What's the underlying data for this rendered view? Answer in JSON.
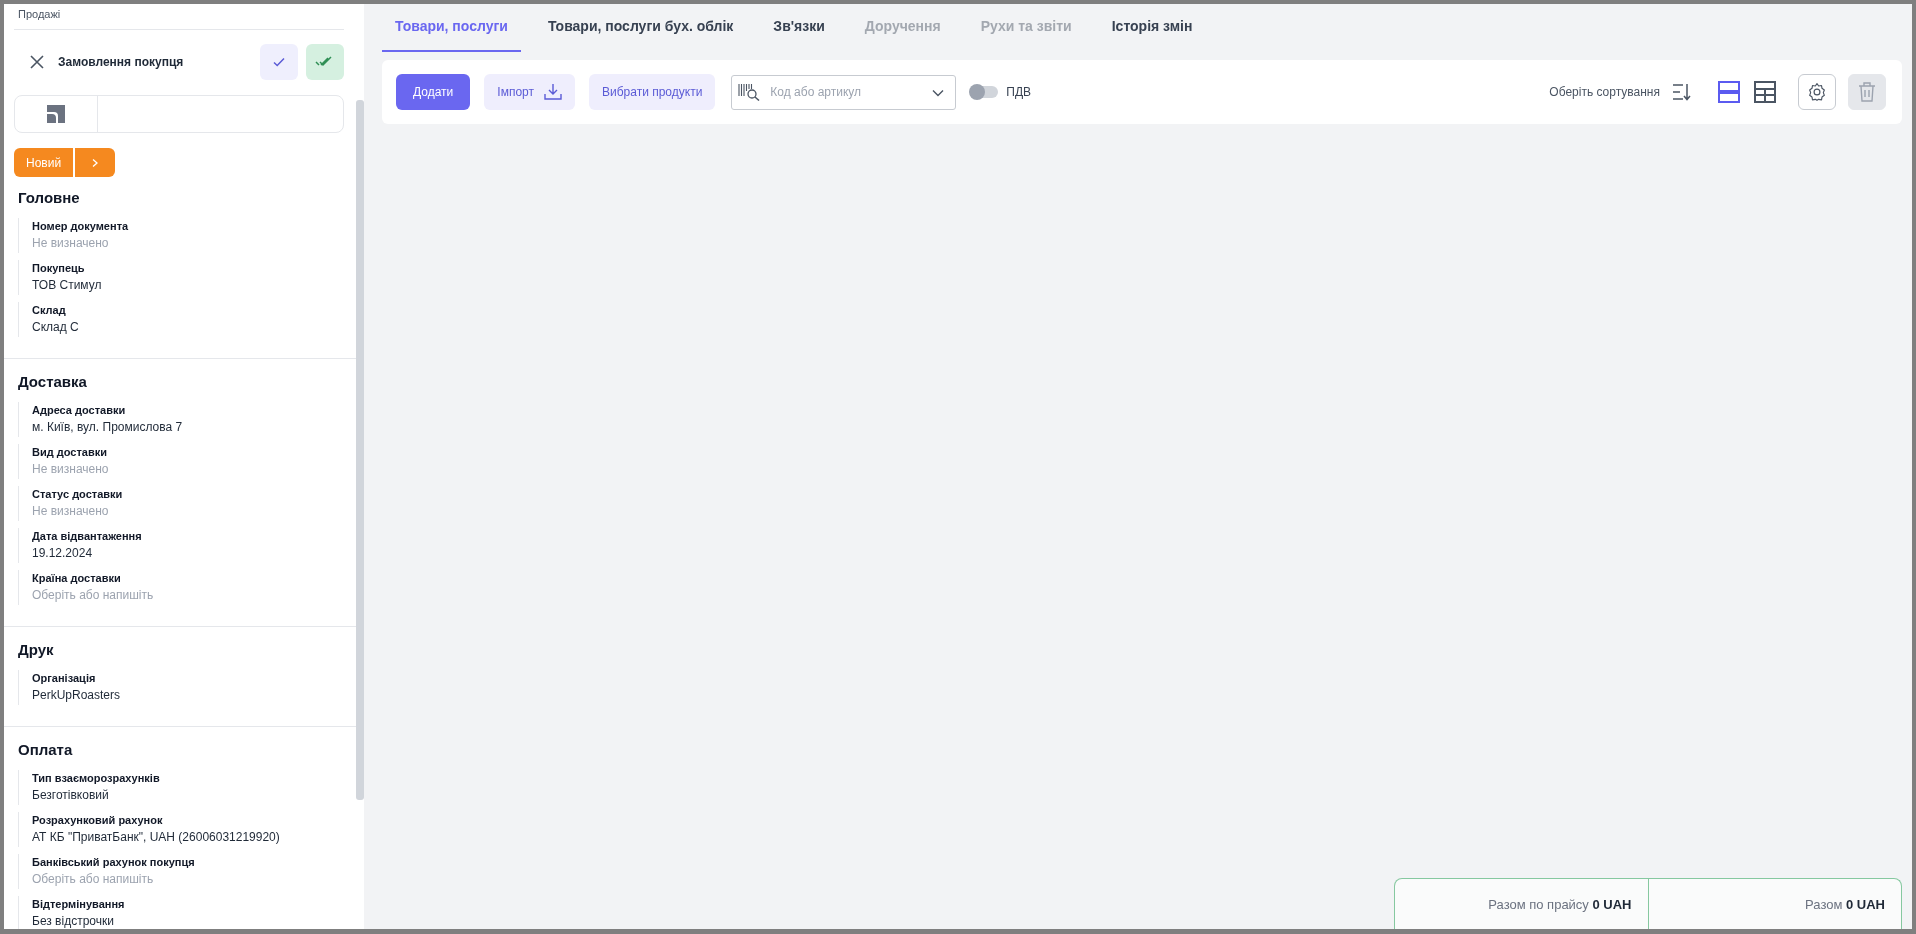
{
  "breadcrumb": "Продажі",
  "document": {
    "title": "Замовлення покупця"
  },
  "status": {
    "label": "Новий"
  },
  "sections": [
    {
      "title": "Головне",
      "fields": [
        {
          "label": "Номер документа",
          "placeholder": "Не визначено"
        },
        {
          "label": "Покупець",
          "value": "ТОВ Стимул"
        },
        {
          "label": "Склад",
          "value": "Склад С"
        }
      ]
    },
    {
      "title": "Доставка",
      "fields": [
        {
          "label": "Адреса доставки",
          "value": "м. Київ, вул. Промислова 7"
        },
        {
          "label": "Вид доставки",
          "placeholder": "Не визначено"
        },
        {
          "label": "Статус доставки",
          "placeholder": "Не визначено"
        },
        {
          "label": "Дата відвантаження",
          "value": "19.12.2024"
        },
        {
          "label": "Країна доставки",
          "placeholder": "Оберіть або напишіть"
        }
      ]
    },
    {
      "title": "Друк",
      "fields": [
        {
          "label": "Організація",
          "value": "PerkUpRoasters"
        }
      ]
    },
    {
      "title": "Оплата",
      "fields": [
        {
          "label": "Тип взаєморозрахунків",
          "value": "Безготівковий"
        },
        {
          "label": "Розрахунковий рахунок",
          "value": "АТ КБ \"ПриватБанк\", UAH (26006031219920)"
        },
        {
          "label": "Банківський рахунок покупця",
          "placeholder": "Оберіть або напишіть"
        },
        {
          "label": "Відтермінування",
          "value": "Без відстрочки"
        }
      ]
    }
  ],
  "tabs": [
    {
      "label": "Товари, послуги",
      "selected": true,
      "disabled": false
    },
    {
      "label": "Товари, послуги бух. облік",
      "selected": false,
      "disabled": false
    },
    {
      "label": "Зв'язки",
      "selected": false,
      "disabled": false
    },
    {
      "label": "Доручення",
      "selected": false,
      "disabled": true
    },
    {
      "label": "Рухи та звіти",
      "selected": false,
      "disabled": true
    },
    {
      "label": "Історія змін",
      "selected": false,
      "disabled": false
    }
  ],
  "toolbar": {
    "add_button": "Додати",
    "import_button": "Імпорт",
    "select_button": "Вибрати продукти",
    "search": {
      "placeholder": "Код або артикул"
    },
    "vat_toggle": {
      "label": "ПДВ",
      "on": false
    },
    "sort": {
      "label": "Оберіть сортування"
    },
    "views": [
      {
        "kind": "rows",
        "selected": true
      },
      {
        "kind": "grid",
        "selected": false
      }
    ],
    "delete": {
      "disabled": true
    }
  },
  "totals": [
    {
      "text": "Разом по прайсу **0 UAH**"
    },
    {
      "text": "Разом **0 UAH**"
    }
  ]
}
